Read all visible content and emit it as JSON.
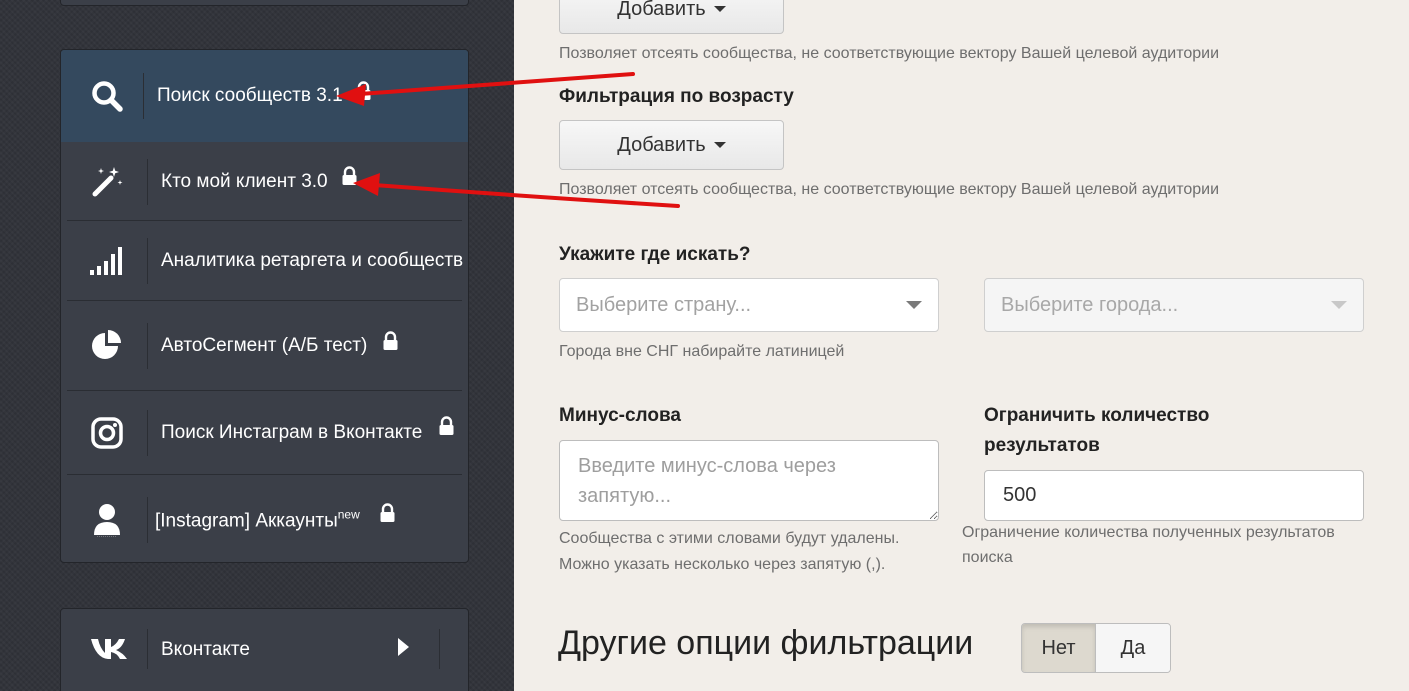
{
  "sidebar": {
    "menu": [
      {
        "label": "Поиск сообществ 3.1",
        "icon": "search-icon",
        "locked": true,
        "active": true
      },
      {
        "label": "Кто мой клиент 3.0",
        "icon": "magic-wand-icon",
        "locked": true
      },
      {
        "label": "Аналитика ретаргета и сообществ",
        "icon": "signal-bars-icon",
        "locked": true
      },
      {
        "label": "АвтоСегмент (А/Б тест)",
        "icon": "pie-chart-icon",
        "locked": true
      },
      {
        "label": "Поиск Инстаграм в Вконтакте",
        "icon": "instagram-icon",
        "locked": true
      },
      {
        "label": "[Instagram] Аккаунты",
        "sup": "new",
        "icon": "user-icon",
        "locked": true
      }
    ],
    "vk": {
      "label": "Вконтакте",
      "icon": "vk-logo-icon"
    }
  },
  "main": {
    "top_add_button": "Добавить",
    "top_help": "Позволяет отсеять сообщества, не соответствующие вектору Вашей целевой аудитории",
    "age_filter": {
      "heading": "Фильтрация по возрасту",
      "button": "Добавить",
      "help": "Позволяет отсеять сообщества, не соответствующие вектору Вашей целевой аудитории"
    },
    "location": {
      "heading": "Укажите где искать?",
      "country_placeholder": "Выберите страну...",
      "city_placeholder": "Выберите города...",
      "help": "Города вне СНГ набирайте латиницей"
    },
    "minus_words": {
      "heading": "Минус-слова",
      "placeholder": "Введите минус-слова через запятую...",
      "help_line1": "Сообщества с этими словами будут удалены.",
      "help_line2": "Можно указать несколько через запятую (,)."
    },
    "limit": {
      "heading_line1": "Ограничить количество",
      "heading_line2": "результатов",
      "value": "500",
      "help_line1": "Ограничение количества полученных результатов",
      "help_line2": "поиска"
    },
    "other_options": {
      "title": "Другие опции фильтрации",
      "no": "Нет",
      "yes": "Да",
      "selected": "Нет"
    }
  },
  "colors": {
    "annotation_arrow": "#e01010",
    "sidebar_active": "#34495e"
  }
}
